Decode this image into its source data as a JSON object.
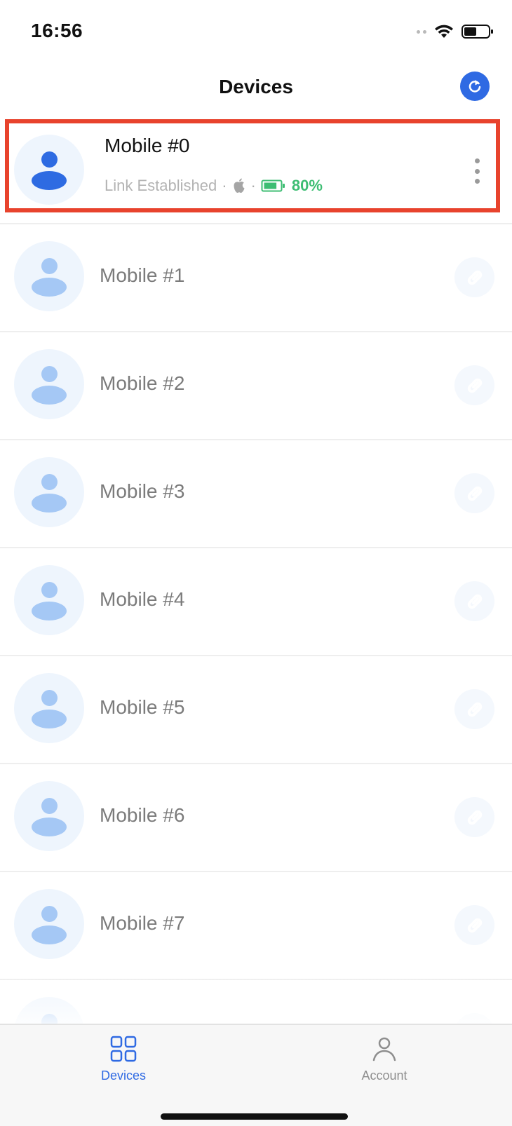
{
  "status_bar": {
    "time": "16:56"
  },
  "header": {
    "title": "Devices",
    "refresh_icon": "refresh-icon"
  },
  "devices": [
    {
      "name": "Mobile #0",
      "status": "Link Established",
      "platform_icon": "apple-icon",
      "battery_icon": "battery-icon",
      "battery": "80%",
      "battery_level": 0.8,
      "highlighted": true
    },
    {
      "name": "Mobile #1",
      "action_icon": "link-icon"
    },
    {
      "name": "Mobile #2",
      "action_icon": "link-icon"
    },
    {
      "name": "Mobile #3",
      "action_icon": "link-icon"
    },
    {
      "name": "Mobile #4",
      "action_icon": "link-icon"
    },
    {
      "name": "Mobile #5",
      "action_icon": "link-icon"
    },
    {
      "name": "Mobile #6",
      "action_icon": "link-icon"
    },
    {
      "name": "Mobile #7",
      "action_icon": "link-icon"
    }
  ],
  "tab_bar": {
    "devices_label": "Devices",
    "account_label": "Account"
  },
  "colors": {
    "accent": "#2f6ae3",
    "battery_green": "#3dbd73",
    "highlight": "#e8432d",
    "avatar_light": "#a5c8f5"
  }
}
